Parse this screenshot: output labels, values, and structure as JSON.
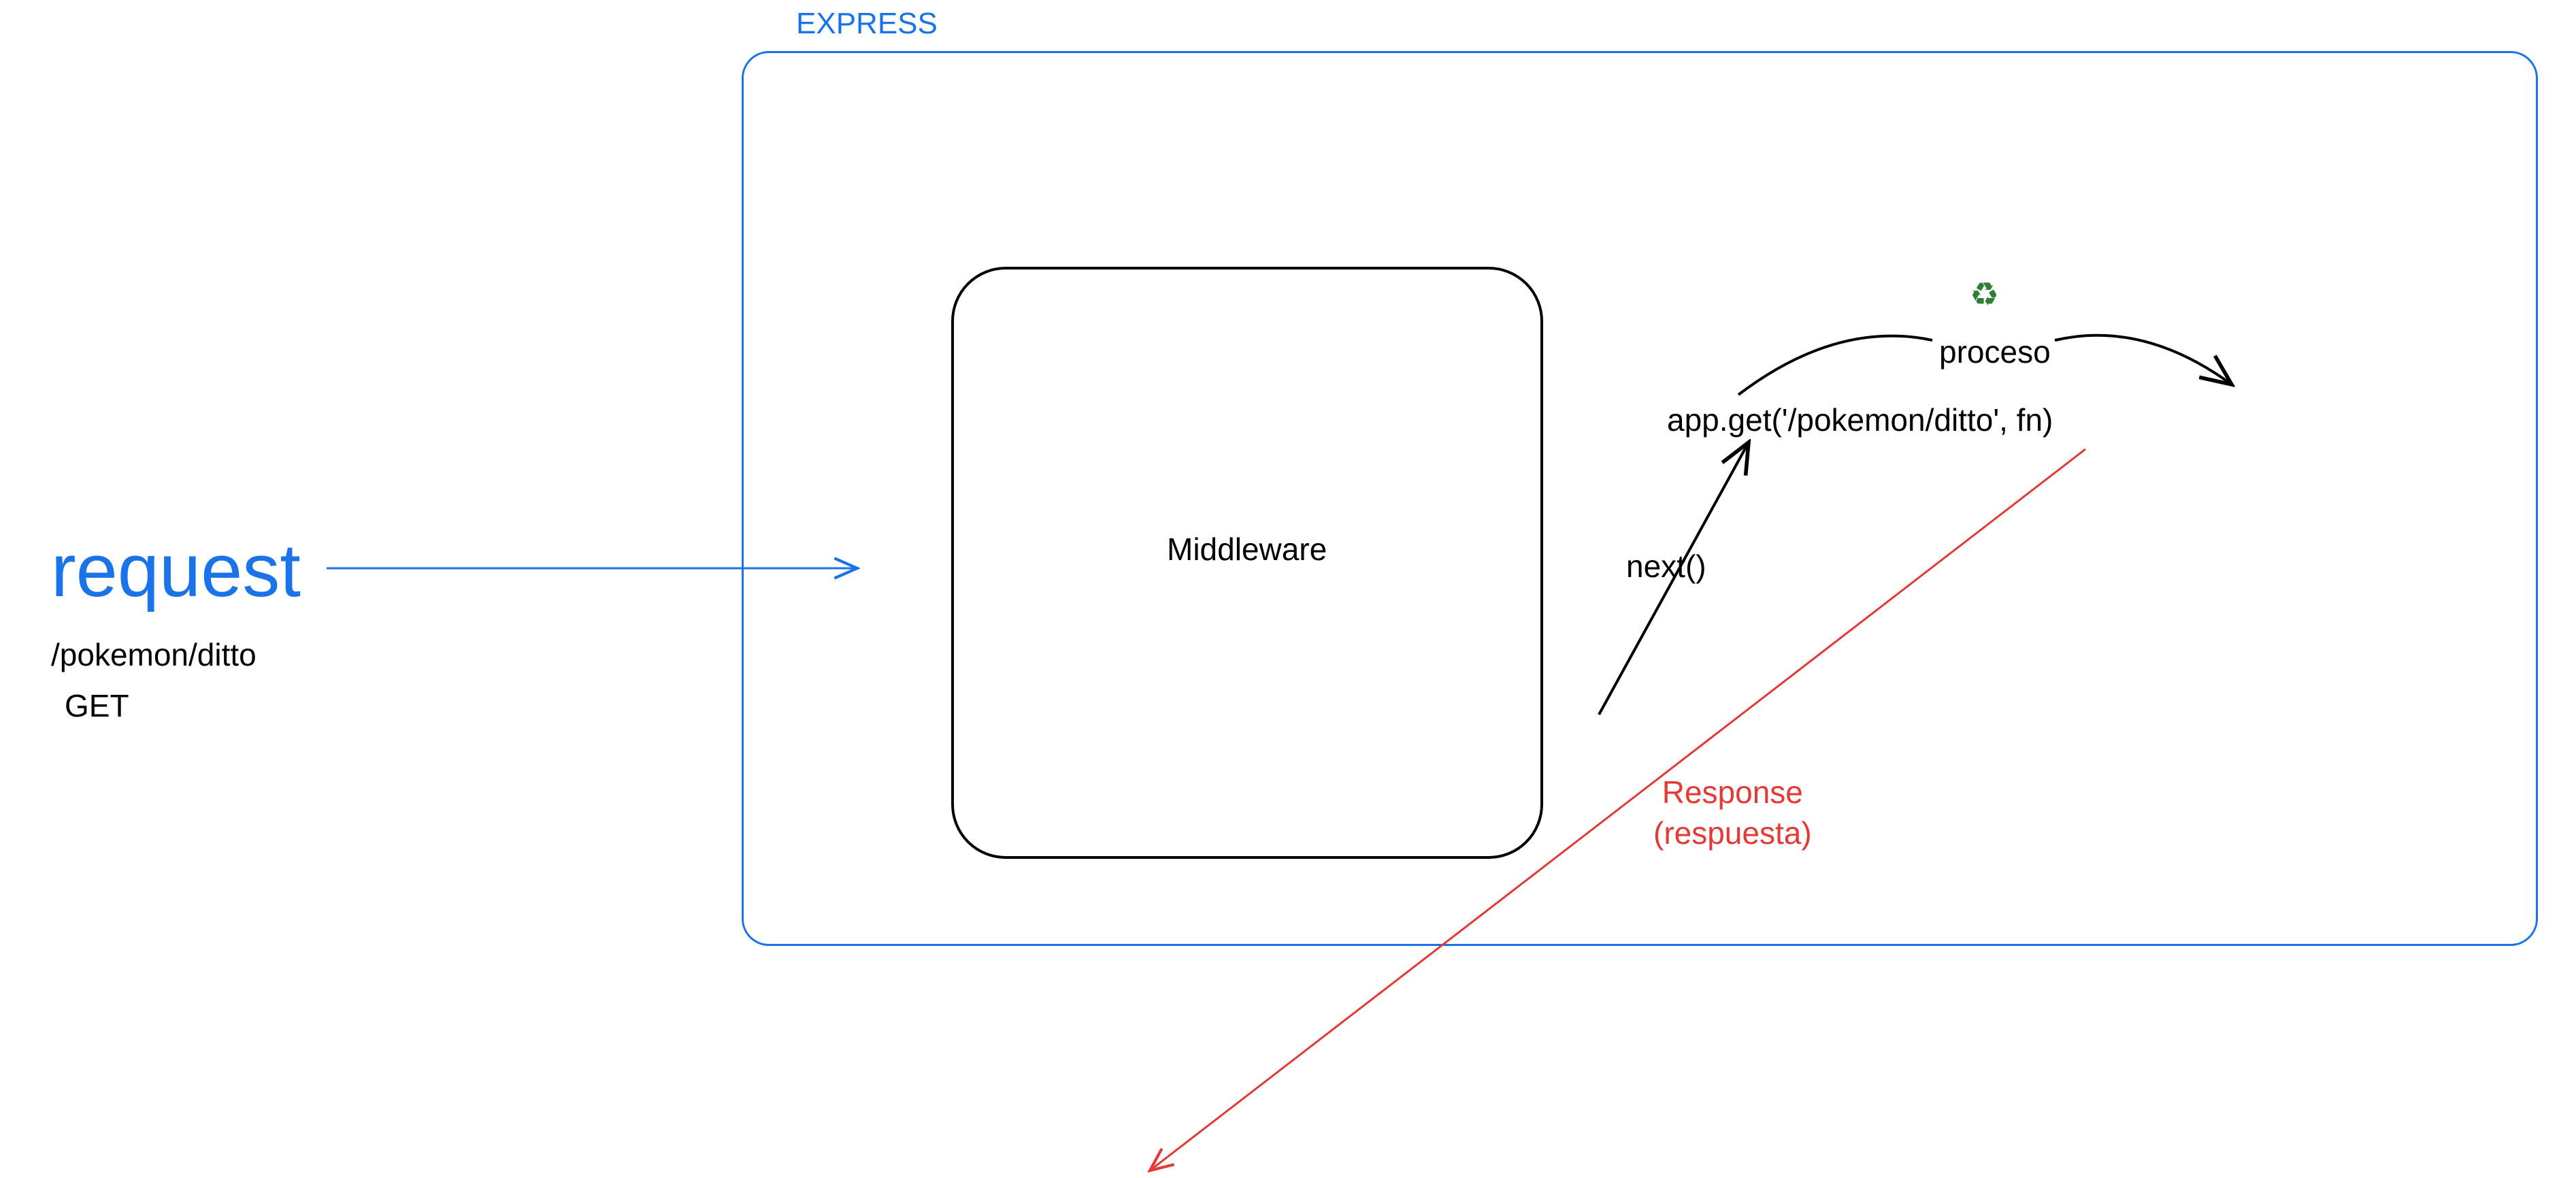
{
  "diagram": {
    "express_label": "EXPRESS",
    "middleware_label": "Middleware",
    "request_label": "request",
    "request_path": "/pokemon/ditto",
    "request_method": "GET",
    "next_label": "next()",
    "appget_label": "app.get('/pokemon/ditto', fn)",
    "proceso_label": "proceso",
    "recycle_icon": "♻",
    "response_line1": "Response",
    "response_line2": "(respuesta)"
  },
  "colors": {
    "blue": "#1a73e8",
    "black": "#000000",
    "red": "#e53935",
    "green": "#2e7d32"
  }
}
